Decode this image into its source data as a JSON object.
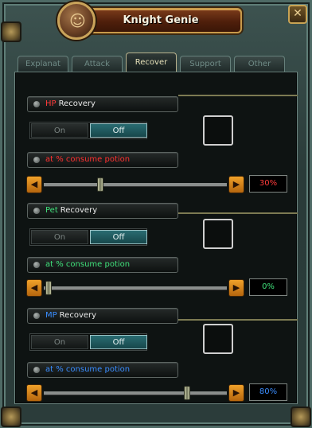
{
  "window": {
    "title": "Knight Genie",
    "close_symbol": "✕",
    "medallion_icon": "genie-medallion-icon"
  },
  "tabs": [
    {
      "label": "Explanat",
      "active": false
    },
    {
      "label": "Attack",
      "active": false
    },
    {
      "label": "Recover",
      "active": true
    },
    {
      "label": "Support",
      "active": false
    },
    {
      "label": "Other",
      "active": false
    }
  ],
  "sections": [
    {
      "keyword": "HP",
      "keyword_color": "#ff3a3a",
      "title_suffix": "Recovery",
      "toggle": {
        "on_label": "On",
        "off_label": "Off",
        "selected": "Off"
      },
      "potion_label": "at % consume potion",
      "potion_color": "#ff3030",
      "slider_fraction": 0.3,
      "value_text": "30%",
      "value_color": "#ff3a3a"
    },
    {
      "keyword": "Pet",
      "keyword_color": "#3fe07a",
      "title_suffix": "Recovery",
      "toggle": {
        "on_label": "On",
        "off_label": "Off",
        "selected": "Off"
      },
      "potion_label": "at % consume potion",
      "potion_color": "#3fe07a",
      "slider_fraction": 0.0,
      "value_text": "0%",
      "value_color": "#3fe07a"
    },
    {
      "keyword": "MP",
      "keyword_color": "#3a8dff",
      "title_suffix": "Recovery",
      "toggle": {
        "on_label": "On",
        "off_label": "Off",
        "selected": "Off"
      },
      "potion_label": "at % consume potion",
      "potion_color": "#3a8dff",
      "slider_fraction": 0.8,
      "value_text": "80%",
      "value_color": "#3a8dff"
    }
  ],
  "arrows": {
    "left": "◀",
    "right": "▶"
  }
}
